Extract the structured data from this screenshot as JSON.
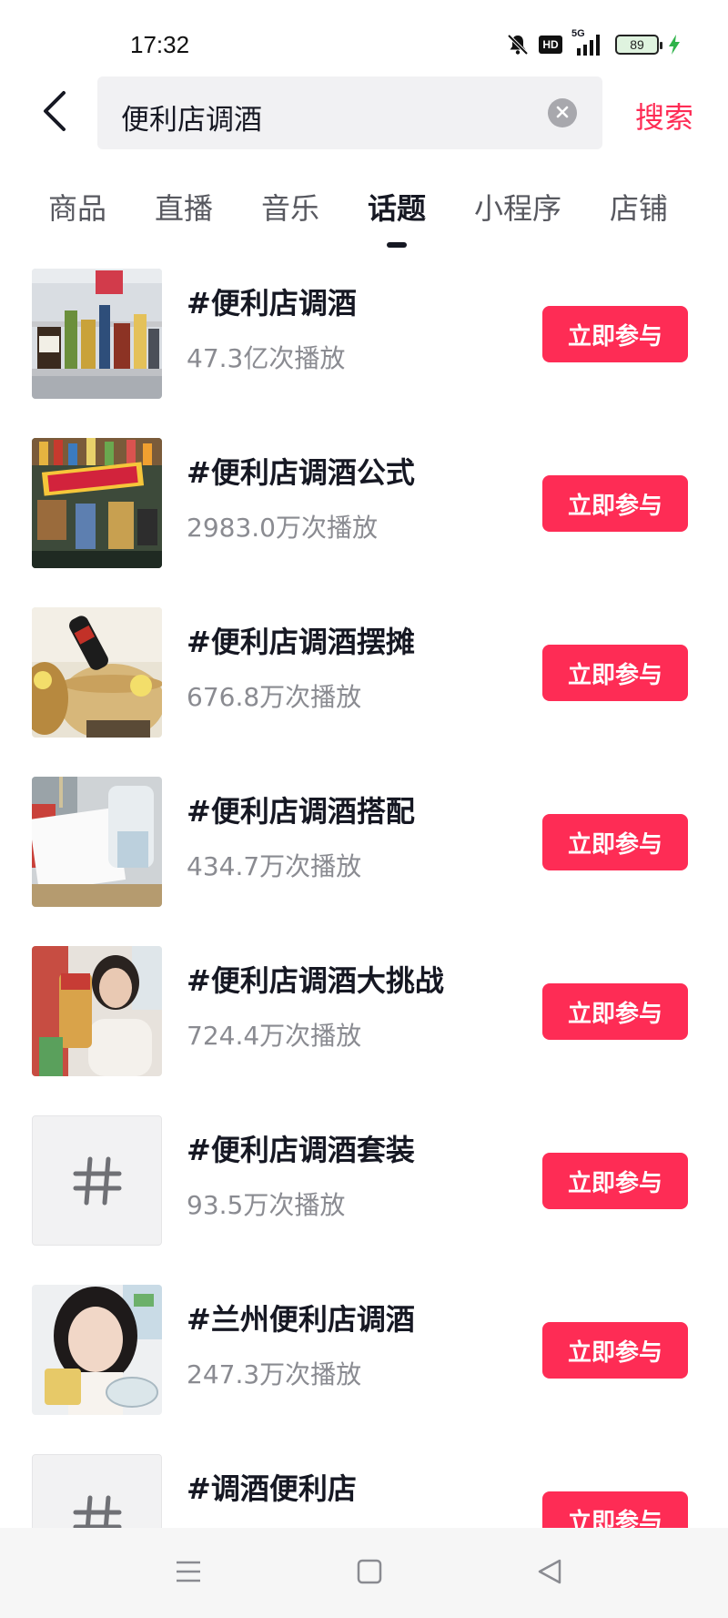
{
  "status_bar": {
    "time": "17:32",
    "icons": [
      "mute-bell-icon",
      "hd-icon",
      "5g-signal-icon",
      "battery-icon",
      "charging-icon"
    ],
    "hd_label": "HD",
    "network_label": "5G",
    "battery_level": "89"
  },
  "search": {
    "query": "便利店调酒",
    "submit_label": "搜索"
  },
  "tabs": {
    "items": [
      {
        "label": "商品"
      },
      {
        "label": "直播"
      },
      {
        "label": "音乐"
      },
      {
        "label": "话题"
      },
      {
        "label": "小程序"
      },
      {
        "label": "店铺"
      }
    ],
    "active": "话题"
  },
  "topics": [
    {
      "title": "#便利店调酒",
      "plays": "47.3亿次播放",
      "action": "立即参与",
      "thumb": "photo"
    },
    {
      "title": "#便利店调酒公式",
      "plays": "2983.0万次播放",
      "action": "立即参与",
      "thumb": "photo"
    },
    {
      "title": "#便利店调酒摆摊",
      "plays": "676.8万次播放",
      "action": "立即参与",
      "thumb": "photo"
    },
    {
      "title": "#便利店调酒搭配",
      "plays": "434.7万次播放",
      "action": "立即参与",
      "thumb": "photo"
    },
    {
      "title": "#便利店调酒大挑战",
      "plays": "724.4万次播放",
      "action": "立即参与",
      "thumb": "photo"
    },
    {
      "title": "#便利店调酒套装",
      "plays": "93.5万次播放",
      "action": "立即参与",
      "thumb": "hash"
    },
    {
      "title": "#兰州便利店调酒",
      "plays": "247.3万次播放",
      "action": "立即参与",
      "thumb": "photo"
    },
    {
      "title": "#调酒便利店",
      "plays": "",
      "action": "立即参与",
      "thumb": "hash"
    }
  ],
  "colors": {
    "accent": "#fe2c55",
    "text_primary": "#161823",
    "text_secondary": "#8a8b91"
  }
}
